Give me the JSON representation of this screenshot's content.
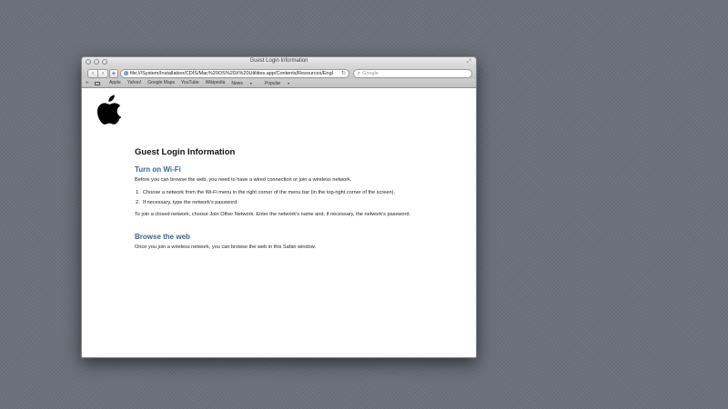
{
  "window": {
    "title": "Guest Login Information"
  },
  "toolbar": {
    "back_icon": "chevron-left-icon",
    "forward_icon": "chevron-right-icon",
    "add_label": "+",
    "address": "file:///System/Installation/CDIS/Mac%20OS%20X%20Utilities.app/Contents/Resources/Engl",
    "search_placeholder": "Google"
  },
  "bookmarks": {
    "items": [
      {
        "label": "Apple"
      },
      {
        "label": "Yahoo!"
      },
      {
        "label": "Google Maps"
      },
      {
        "label": "YouTube"
      },
      {
        "label": "Wikipedia"
      },
      {
        "label": "News"
      },
      {
        "label": "Popular"
      }
    ]
  },
  "page": {
    "logo": "apple-logo",
    "title": "Guest Login Information",
    "section1": {
      "heading": "Turn on Wi-Fi",
      "intro": "Before you can browse the web, you need to have a wired connection or join a wireless network.",
      "steps": [
        {
          "num": "1.",
          "text": "Choose a network from the Wi-Fi menu in the right corner of the menu bar (in the top-right corner of the screen)."
        },
        {
          "num": "2.",
          "text": "If necessary, type the network's password."
        }
      ],
      "note": "To join a closed network, choose Join Other Network. Enter the network's name and, if necessary, the network's password."
    },
    "section2": {
      "heading": "Browse the web",
      "text": "Once you join a wireless network, you can browse the web in this Safari window."
    }
  }
}
